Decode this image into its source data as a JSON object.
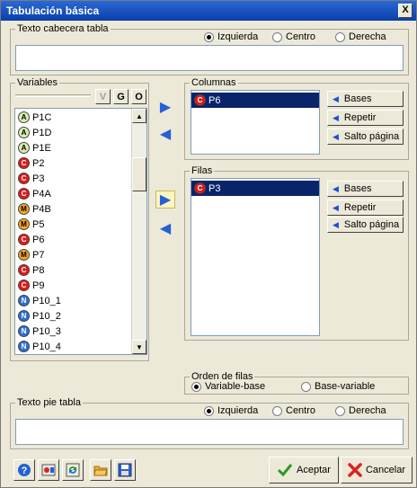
{
  "window": {
    "title": "Tabulación básica",
    "close_label": "X"
  },
  "header_group": {
    "label": "Texto cabecera tabla",
    "options": [
      "Izquierda",
      "Centro",
      "Derecha"
    ],
    "selected": "Izquierda",
    "value": ""
  },
  "variables": {
    "label": "Variables",
    "buttons": {
      "v": "V",
      "g": "G",
      "o": "O"
    },
    "items": [
      {
        "icon": "A",
        "label": "P1C"
      },
      {
        "icon": "A",
        "label": "P1D"
      },
      {
        "icon": "A",
        "label": "P1E"
      },
      {
        "icon": "C",
        "label": "P2"
      },
      {
        "icon": "C",
        "label": "P3"
      },
      {
        "icon": "C",
        "label": "P4A"
      },
      {
        "icon": "M",
        "label": "P4B"
      },
      {
        "icon": "M",
        "label": "P5"
      },
      {
        "icon": "C",
        "label": "P6"
      },
      {
        "icon": "M",
        "label": "P7"
      },
      {
        "icon": "C",
        "label": "P8"
      },
      {
        "icon": "C",
        "label": "P9"
      },
      {
        "icon": "N",
        "label": "P10_1"
      },
      {
        "icon": "N",
        "label": "P10_2"
      },
      {
        "icon": "N",
        "label": "P10_3"
      },
      {
        "icon": "N",
        "label": "P10_4"
      }
    ]
  },
  "columnas": {
    "label": "Columnas",
    "items": [
      {
        "icon": "C",
        "label": "P6"
      }
    ],
    "buttons": [
      "Bases",
      "Repetir",
      "Salto página"
    ]
  },
  "filas": {
    "label": "Filas",
    "items": [
      {
        "icon": "C",
        "label": "P3"
      }
    ],
    "buttons": [
      "Bases",
      "Repetir",
      "Salto página"
    ]
  },
  "orden": {
    "label": "Orden de filas",
    "options": [
      "Variable-base",
      "Base-variable"
    ],
    "selected": "Variable-base"
  },
  "footer_group": {
    "label": "Texto pie tabla",
    "options": [
      "Izquierda",
      "Centro",
      "Derecha"
    ],
    "selected": "Izquierda",
    "value": ""
  },
  "toolbar": {
    "icons": [
      "help-icon",
      "settings-icon",
      "refresh-icon",
      "open-folder-icon",
      "save-icon"
    ],
    "accept_label": "Aceptar",
    "cancel_label": "Cancelar"
  },
  "colors": {
    "titlebar": "#0a3ea8",
    "selection": "#0a246a",
    "arrow": "#2461d6"
  }
}
